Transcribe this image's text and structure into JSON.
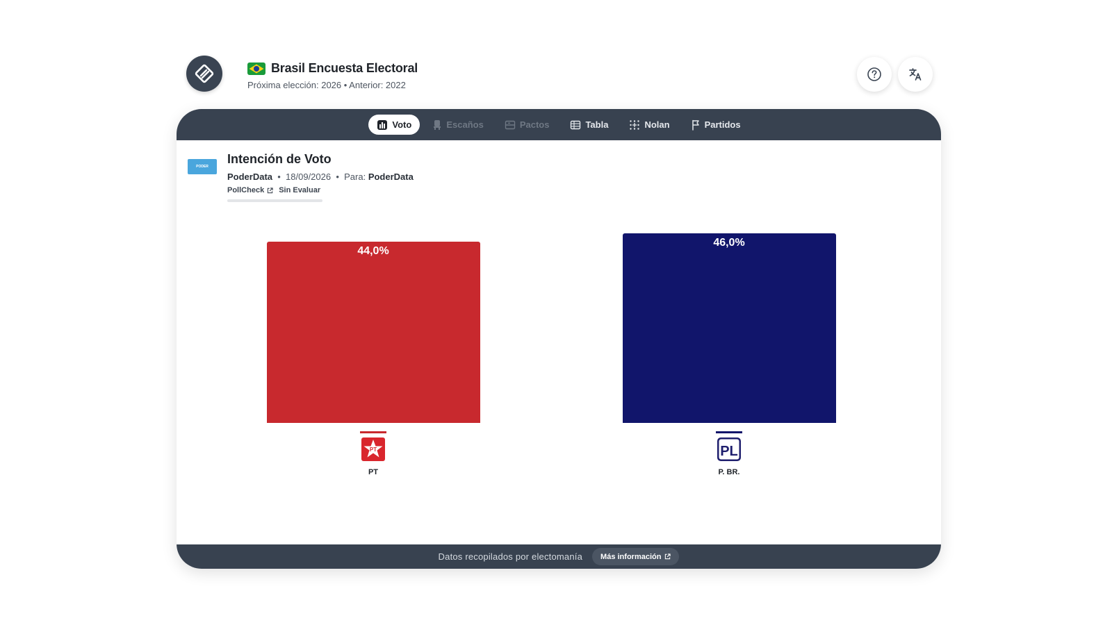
{
  "header": {
    "title": "Brasil Encuesta Electoral",
    "subtitle": "Próxima elección: 2026 • Anterior: 2022",
    "logo_icon": "pen-diamond-icon",
    "flag_icon": "brazil-flag-icon",
    "help_icon": "help-icon",
    "language_icon": "translate-icon"
  },
  "tabs": [
    {
      "label": "Voto",
      "icon": "bar-chart-icon",
      "state": "active"
    },
    {
      "label": "Escaños",
      "icon": "seat-icon",
      "state": "disabled"
    },
    {
      "label": "Pactos",
      "icon": "pact-icon",
      "state": "disabled"
    },
    {
      "label": "Tabla",
      "icon": "table-icon",
      "state": "normal"
    },
    {
      "label": "Nolan",
      "icon": "grid-dots-icon",
      "state": "normal"
    },
    {
      "label": "Partidos",
      "icon": "flag-icon",
      "state": "normal"
    }
  ],
  "poll": {
    "title": "Intención de Voto",
    "pollster": "PoderData",
    "date": "18/09/2026",
    "for_label": "Para:",
    "client": "PoderData",
    "pollcheck_label": "PollCheck",
    "rating": "Sin Evaluar",
    "logo_text": "PODER"
  },
  "chart_data": {
    "type": "bar",
    "categories": [
      "PT",
      "P. BR."
    ],
    "values": [
      44.0,
      46.0
    ],
    "value_labels": [
      "44,0%",
      "46,0%"
    ],
    "colors": [
      "#c8292e",
      "#11156b"
    ],
    "ylim": [
      0,
      46.0
    ],
    "title": "",
    "xlabel": "",
    "ylabel": ""
  },
  "footer": {
    "text": "Datos recopilados por electomanía",
    "button_label": "Más información"
  }
}
